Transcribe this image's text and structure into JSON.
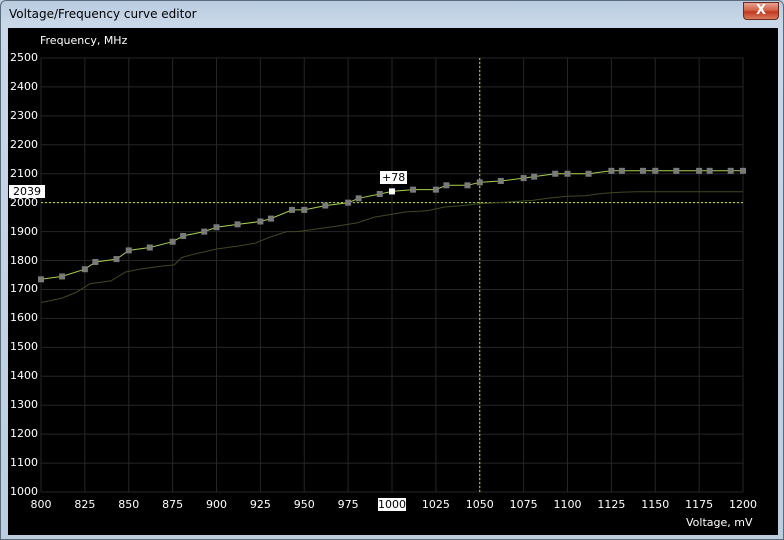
{
  "window": {
    "title": "Voltage/Frequency curve editor",
    "close_label": "X"
  },
  "colors": {
    "curve": "#a6d24a",
    "baseline": "#3e4a22",
    "point": "#7a7a7a",
    "selected_point": "#ffffff",
    "grid": "#262626",
    "crosshair": "#b8e23a"
  },
  "chart_data": {
    "type": "line",
    "xlabel": "Voltage, mV",
    "ylabel": "Frequency, MHz",
    "xlim": [
      800,
      1200
    ],
    "ylim": [
      1000,
      2500
    ],
    "x_ticks": [
      "800",
      "825",
      "850",
      "875",
      "900",
      "925",
      "950",
      "975",
      "1000",
      "1025",
      "1050",
      "1075",
      "1100",
      "1125",
      "1150",
      "1175",
      "1200"
    ],
    "y_ticks": [
      "2500",
      "2400",
      "2300",
      "2200",
      "2100",
      "2000",
      "1900",
      "1800",
      "1700",
      "1600",
      "1500",
      "1400",
      "1300",
      "1200",
      "1100",
      "1000"
    ],
    "grid": true,
    "crosshair": {
      "x": 1050,
      "y": 2000
    },
    "highlight_x_label": "1000",
    "highlight_y_label": "2039",
    "selected_point": {
      "x": 1000,
      "y": 2039,
      "offset_label": "+78"
    },
    "series": [
      {
        "role": "curve",
        "x": [
          800,
          812,
          825,
          831,
          843,
          850,
          862,
          875,
          881,
          893,
          900,
          912,
          925,
          931,
          943,
          950,
          962,
          975,
          981,
          993,
          1000,
          1012,
          1025,
          1031,
          1043,
          1050,
          1062,
          1075,
          1081,
          1093,
          1100,
          1112,
          1125,
          1131,
          1143,
          1150,
          1162,
          1175,
          1181,
          1193,
          1200
        ],
        "y": [
          1735,
          1745,
          1770,
          1795,
          1805,
          1835,
          1845,
          1865,
          1885,
          1900,
          1915,
          1925,
          1935,
          1945,
          1975,
          1975,
          1990,
          2000,
          2015,
          2030,
          2039,
          2045,
          2045,
          2060,
          2060,
          2070,
          2075,
          2085,
          2090,
          2100,
          2100,
          2100,
          2110,
          2110,
          2110,
          2110,
          2110,
          2110,
          2110,
          2110,
          2110
        ]
      },
      {
        "role": "baseline",
        "x": [
          800,
          812,
          820,
          828,
          840,
          848,
          856,
          868,
          876,
          880,
          886,
          900,
          912,
          922,
          930,
          940,
          946,
          958,
          970,
          980,
          990,
          1000,
          1008,
          1020,
          1030,
          1040,
          1050,
          1060,
          1070,
          1080,
          1090,
          1100,
          1110,
          1120,
          1130,
          1140,
          1150,
          1160,
          1170,
          1180,
          1190,
          1200
        ],
        "y": [
          1655,
          1670,
          1690,
          1720,
          1730,
          1760,
          1770,
          1780,
          1785,
          1810,
          1820,
          1840,
          1850,
          1860,
          1880,
          1900,
          1900,
          1910,
          1920,
          1930,
          1950,
          1960,
          1968,
          1972,
          1985,
          1990,
          1996,
          2000,
          2004,
          2008,
          2016,
          2022,
          2024,
          2032,
          2036,
          2038,
          2038,
          2038,
          2038,
          2038,
          2038,
          2038
        ]
      }
    ]
  }
}
